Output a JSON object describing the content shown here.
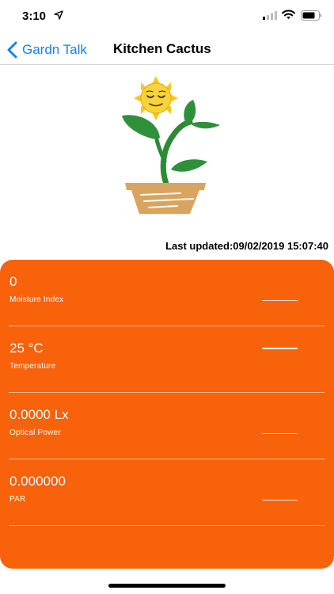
{
  "status_bar": {
    "time": "3:10"
  },
  "nav": {
    "back_label": "Gardn Talk",
    "title": "Kitchen Cactus"
  },
  "last_updated": "Last updated:09/02/2019 15:07:40",
  "sensors": [
    {
      "value": "0",
      "label": "Moisture Index"
    },
    {
      "value": "25 °C",
      "label": "Temperature"
    },
    {
      "value": "0.0000 Lx",
      "label": "Optical Power"
    },
    {
      "value": "0.000000",
      "label": "PAR"
    }
  ],
  "colors": {
    "accent": "#1a7ff0",
    "card": "#f8620b"
  },
  "icons": [
    "location-arrow-icon",
    "signal-icon",
    "wifi-icon",
    "battery-icon",
    "chevron-left-icon",
    "plant-with-sun-illustration"
  ]
}
